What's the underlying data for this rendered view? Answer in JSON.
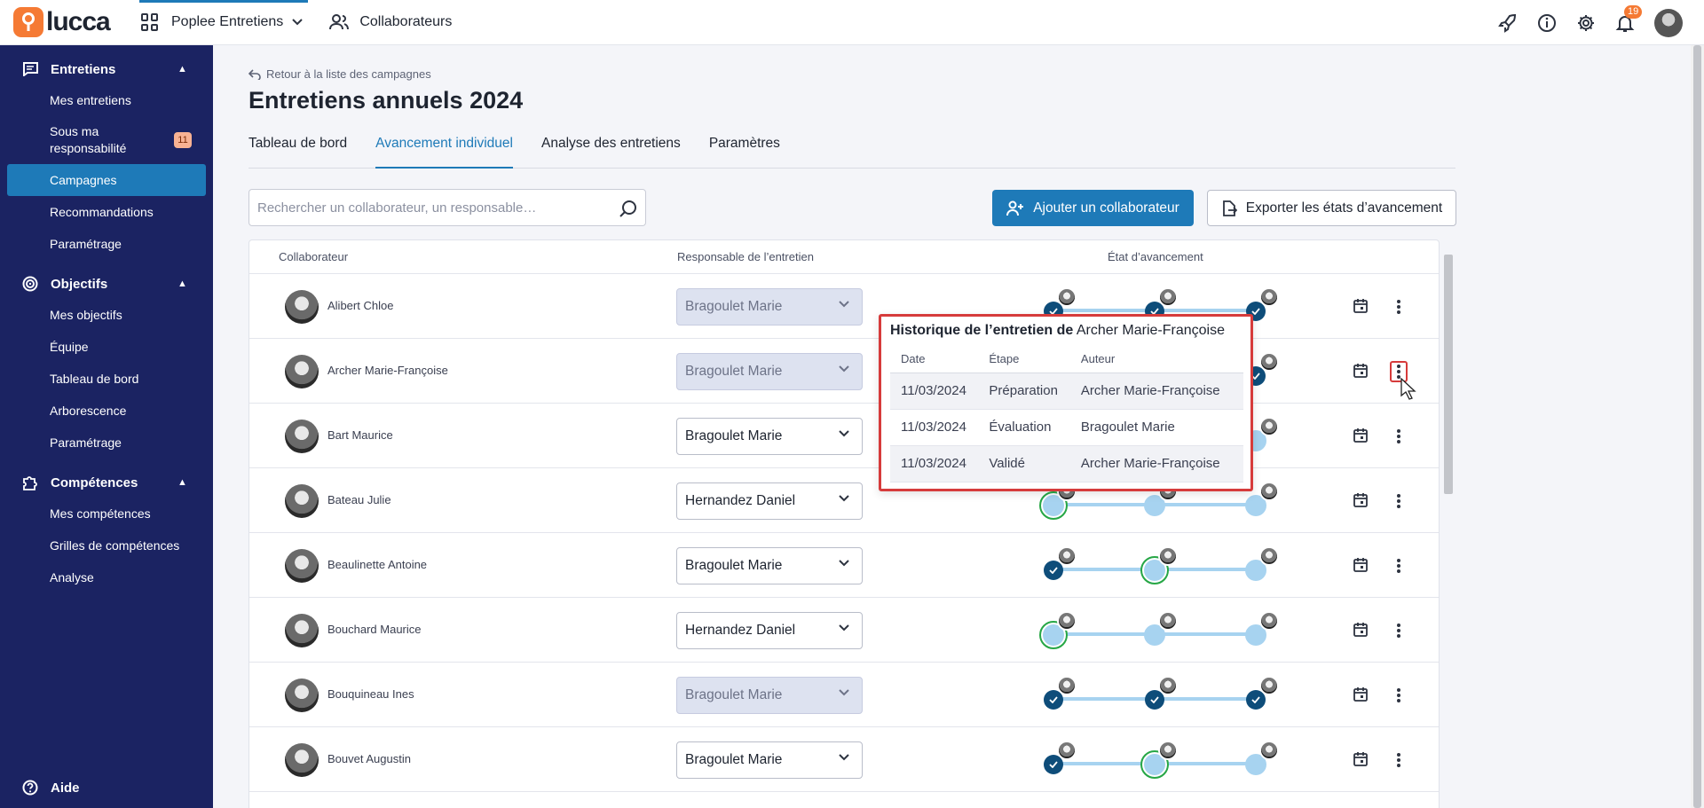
{
  "topbar": {
    "logo_text": "lucca",
    "app_name": "Poplee Entretiens",
    "collab_label": "Collaborateurs",
    "notification_count": "19"
  },
  "sidebar": {
    "sections": [
      {
        "label": "Entretiens",
        "items": [
          {
            "label": "Mes entretiens"
          },
          {
            "label": "Sous ma responsabilité",
            "badge": "11"
          },
          {
            "label": "Campagnes",
            "active": true
          },
          {
            "label": "Recommandations"
          },
          {
            "label": "Paramétrage"
          }
        ]
      },
      {
        "label": "Objectifs",
        "items": [
          {
            "label": "Mes objectifs"
          },
          {
            "label": "Équipe"
          },
          {
            "label": "Tableau de bord"
          },
          {
            "label": "Arborescence"
          },
          {
            "label": "Paramétrage"
          }
        ]
      },
      {
        "label": "Compétences",
        "items": [
          {
            "label": "Mes compétences"
          },
          {
            "label": "Grilles de compétences"
          },
          {
            "label": "Analyse"
          }
        ]
      }
    ],
    "help_label": "Aide"
  },
  "main": {
    "back_label": "Retour à la liste des campagnes",
    "title": "Entretiens annuels 2024",
    "tabs": [
      {
        "label": "Tableau de bord"
      },
      {
        "label": "Avancement individuel",
        "active": true
      },
      {
        "label": "Analyse des entretiens"
      },
      {
        "label": "Paramètres"
      }
    ],
    "search_placeholder": "Rechercher un collaborateur, un responsable…",
    "add_button": "Ajouter un collaborateur",
    "export_button": "Exporter les états d’avancement",
    "table": {
      "headers": [
        "Collaborateur",
        "Responsable de l’entretien",
        "État d’avancement"
      ],
      "rows": [
        {
          "name": "Alibert Chloe",
          "manager": "Bragoulet Marie",
          "locked": true,
          "steps": [
            "done",
            "done",
            "done"
          ]
        },
        {
          "name": "Archer Marie-Françoise",
          "manager": "Bragoulet Marie",
          "locked": true,
          "steps": [
            "done",
            "done",
            "done"
          ]
        },
        {
          "name": "Bart Maurice",
          "manager": "Bragoulet Marie",
          "locked": false,
          "steps": [
            "done",
            "done",
            "todo"
          ]
        },
        {
          "name": "Bateau Julie",
          "manager": "Hernandez Daniel",
          "locked": false,
          "steps": [
            "current",
            "todo",
            "todo"
          ]
        },
        {
          "name": "Beaulinette Antoine",
          "manager": "Bragoulet Marie",
          "locked": false,
          "steps": [
            "done",
            "current",
            "todo"
          ]
        },
        {
          "name": "Bouchard Maurice",
          "manager": "Hernandez Daniel",
          "locked": false,
          "steps": [
            "current",
            "todo",
            "todo"
          ]
        },
        {
          "name": "Bouquineau Ines",
          "manager": "Bragoulet Marie",
          "locked": true,
          "steps": [
            "done",
            "done",
            "done"
          ]
        },
        {
          "name": "Bouvet Augustin",
          "manager": "Bragoulet Marie",
          "locked": false,
          "steps": [
            "done",
            "current",
            "todo"
          ]
        }
      ]
    }
  },
  "popover": {
    "title_prefix": "Historique de l’entretien de",
    "title_name": "Archer Marie-Françoise",
    "headers": [
      "Date",
      "Étape",
      "Auteur"
    ],
    "rows": [
      [
        "11/03/2024",
        "Préparation",
        "Archer Marie-Françoise"
      ],
      [
        "11/03/2024",
        "Évaluation",
        "Bragoulet Marie"
      ],
      [
        "11/03/2024",
        "Validé",
        "Archer Marie-Françoise"
      ]
    ]
  },
  "colors": {
    "sidebar_bg": "#1b2362",
    "accent": "#1e7ab8",
    "brand_orange": "#f57a34",
    "step_done": "#0e4d7a",
    "step_todo": "#a7d3f0",
    "step_current_ring": "#27a745",
    "focus_outline": "#d63b3b"
  }
}
